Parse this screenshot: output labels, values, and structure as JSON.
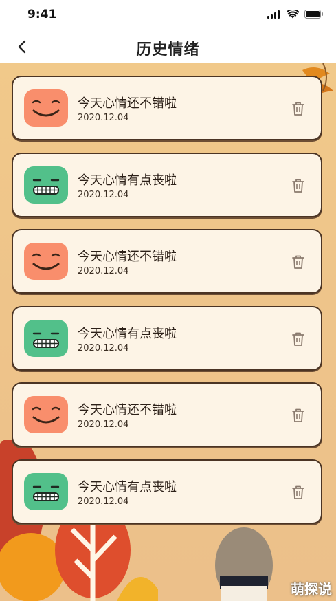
{
  "status_bar": {
    "time": "9:41",
    "icons": [
      "signal-icon",
      "wifi-icon",
      "battery-icon"
    ]
  },
  "nav": {
    "title": "历史情绪",
    "back_icon": "chevron-left-icon"
  },
  "records": [
    {
      "mood": "happy",
      "title": "今天心情还不错啦",
      "date": "2020.12.04"
    },
    {
      "mood": "sad",
      "title": "今天心情有点丧啦",
      "date": "2020.12.04"
    },
    {
      "mood": "happy",
      "title": "今天心情还不错啦",
      "date": "2020.12.04"
    },
    {
      "mood": "sad",
      "title": "今天心情有点丧啦",
      "date": "2020.12.04"
    },
    {
      "mood": "happy",
      "title": "今天心情还不错啦",
      "date": "2020.12.04"
    },
    {
      "mood": "sad",
      "title": "今天心情有点丧啦",
      "date": "2020.12.04"
    }
  ],
  "colors": {
    "happy": "#f98e6c",
    "sad": "#52c08a",
    "background": "#eec48a",
    "card": "#fdf4e6",
    "card_border": "#4b3424"
  },
  "watermark": "萌探说"
}
